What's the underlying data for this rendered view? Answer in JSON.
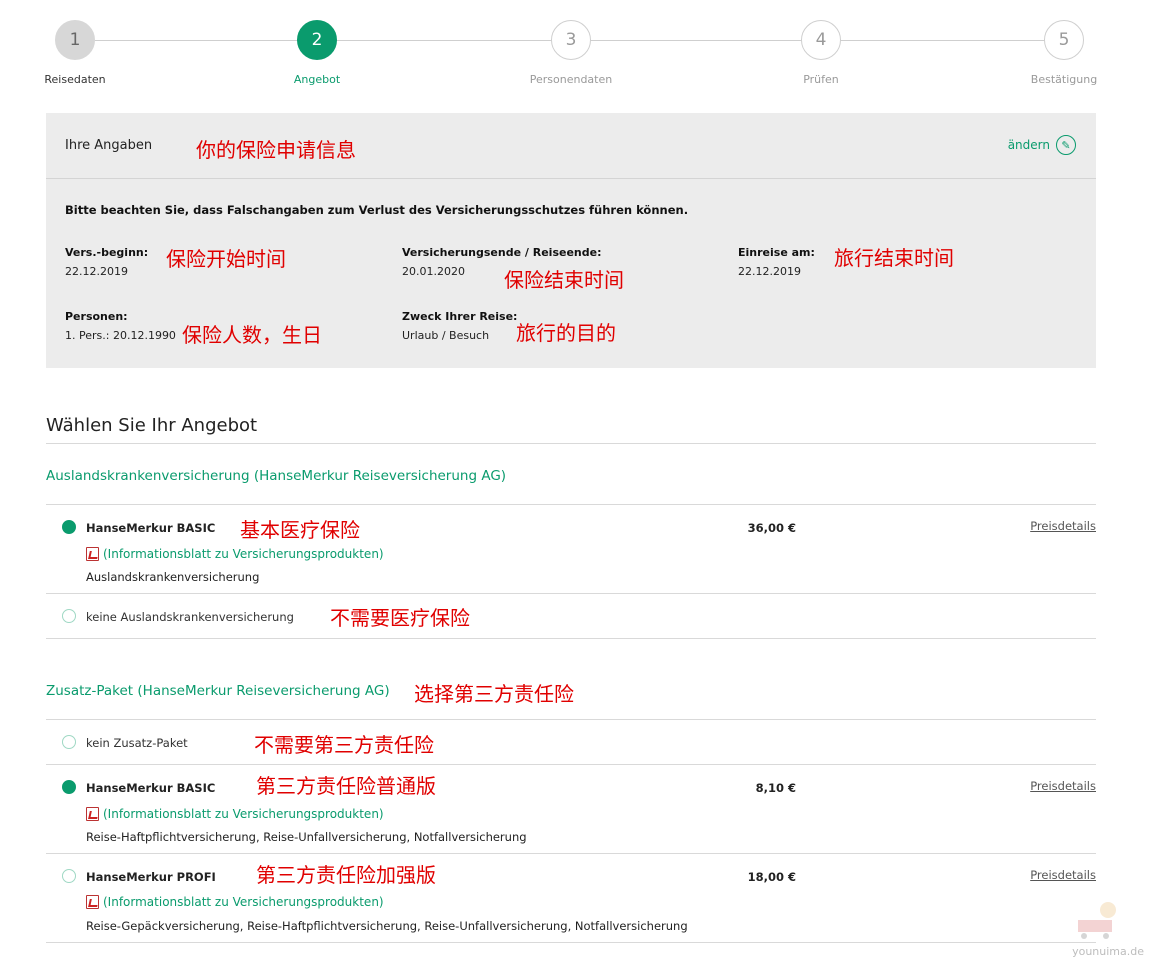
{
  "stepper": {
    "steps": [
      {
        "number": "1",
        "label": "Reisedaten",
        "state": "done"
      },
      {
        "number": "2",
        "label": "Angebot",
        "state": "active"
      },
      {
        "number": "3",
        "label": "Personendaten",
        "state": "upcoming"
      },
      {
        "number": "4",
        "label": "Prüfen",
        "state": "upcoming"
      },
      {
        "number": "5",
        "label": "Bestätigung",
        "state": "upcoming"
      }
    ]
  },
  "panel": {
    "title": "Ihre Angaben",
    "edit_label": "ändern",
    "edit_icon": "pencil-icon",
    "notice": "Bitte beachten Sie, dass Falschangaben zum Verlust des Versicherungsschutzes führen können.",
    "fields": {
      "start": {
        "label": "Vers.-beginn:",
        "value": "22.12.2019"
      },
      "end": {
        "label": "Versicherungsende / Reiseende:",
        "value": "20.01.2020"
      },
      "entry": {
        "label": "Einreise am:",
        "value": "22.12.2019"
      },
      "persons": {
        "label": "Personen:",
        "value": "1. Pers.: 20.12.1990"
      },
      "purpose": {
        "label": "Zweck Ihrer Reise:",
        "value": "Urlaub / Besuch"
      }
    }
  },
  "annotations": {
    "panel_title": "你的保险申请信息",
    "start": "保险开始时间",
    "end": "保险结束时间",
    "entry": "旅行结束时间",
    "persons": "保险人数，生日",
    "purpose": "旅行的目的",
    "health_basic": "基本医疗保险",
    "health_none": "不需要医疗保险",
    "addon_group": "选择第三方责任险",
    "addon_none": "不需要第三方责任险",
    "addon_basic": "第三方责任险普通版",
    "addon_profi": "第三方责任险加强版"
  },
  "offer": {
    "section_title": "Wählen Sie Ihr Angebot",
    "health": {
      "group_title": "Auslandskrankenversicherung (HanseMerkur Reiseversicherung AG)",
      "basic": {
        "name": "HanseMerkur BASIC",
        "info_link": "(Informationsblatt zu Versicherungsprodukten)",
        "description": "Auslandskrankenversicherung",
        "price": "36,00 €",
        "details": "Preisdetails",
        "selected": true
      },
      "none": {
        "name": "keine Auslandskrankenversicherung",
        "selected": false
      }
    },
    "addon": {
      "group_title": "Zusatz-Paket (HanseMerkur Reiseversicherung AG)",
      "none": {
        "name": "kein Zusatz-Paket",
        "selected": false
      },
      "basic": {
        "name": "HanseMerkur BASIC",
        "info_link": "(Informationsblatt zu Versicherungsprodukten)",
        "description": "Reise-Haftpflichtversicherung, Reise-Unfallversicherung, Notfallversicherung",
        "price": "8,10 €",
        "details": "Preisdetails",
        "selected": true
      },
      "profi": {
        "name": "HanseMerkur PROFI",
        "info_link": "(Informationsblatt zu Versicherungsprodukten)",
        "description": "Reise-Gepäckversicherung, Reise-Haftpflichtversicherung, Reise-Unfallversicherung, Notfallversicherung",
        "price": "18,00 €",
        "details": "Preisdetails",
        "selected": false
      }
    }
  },
  "watermark": "younuima.de",
  "colors": {
    "accent": "#0a9b6d",
    "annotation": "#e00000",
    "panel_bg": "#ececec"
  }
}
